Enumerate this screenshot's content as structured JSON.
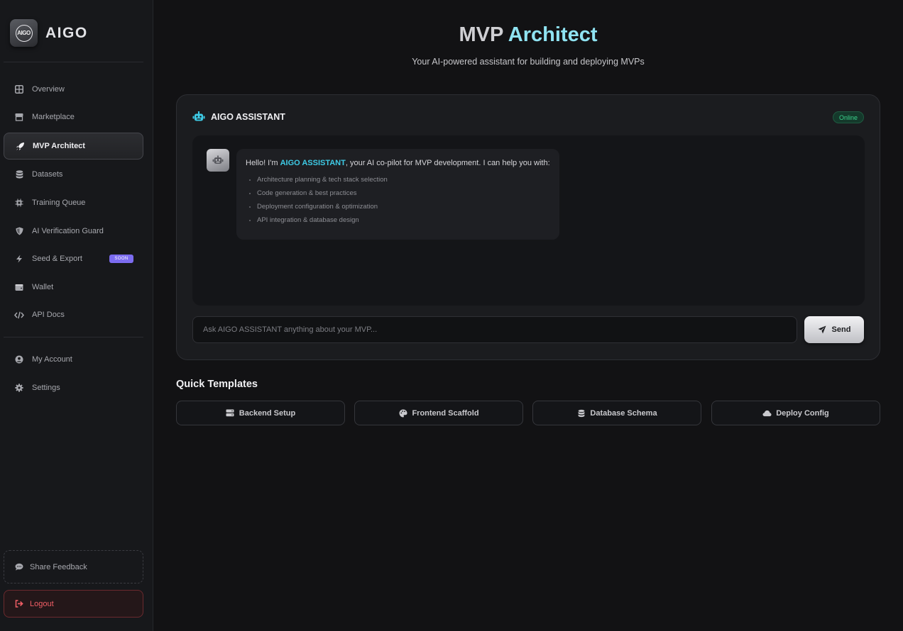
{
  "brand": {
    "name": "AIGO",
    "logo_text": "AIGO"
  },
  "sidebar": {
    "items": [
      {
        "label": "Overview",
        "icon": "grid-icon"
      },
      {
        "label": "Marketplace",
        "icon": "store-icon"
      },
      {
        "label": "MVP Architect",
        "icon": "rocket-icon",
        "active": true
      },
      {
        "label": "Datasets",
        "icon": "database-icon"
      },
      {
        "label": "Training Queue",
        "icon": "chip-icon"
      },
      {
        "label": "AI Verification Guard",
        "icon": "shield-icon"
      },
      {
        "label": "Seed & Export",
        "icon": "bolt-icon",
        "badge": "SOON"
      },
      {
        "label": "Wallet",
        "icon": "wallet-icon"
      },
      {
        "label": "API Docs",
        "icon": "code-icon"
      }
    ],
    "account_items": [
      {
        "label": "My Account",
        "icon": "user-icon"
      },
      {
        "label": "Settings",
        "icon": "gear-icon"
      }
    ],
    "feedback_label": "Share Feedback",
    "logout_label": "Logout"
  },
  "header": {
    "title_part1": "MVP",
    "title_part2": "Architect",
    "subtitle": "Your AI-powered assistant for building and deploying MVPs"
  },
  "assistant": {
    "title": "AIGO ASSISTANT",
    "status": "Online",
    "message": {
      "intro_before": "Hello! I'm ",
      "intro_highlight": "AIGO ASSISTANT",
      "intro_after": ", your AI co-pilot for MVP development. I can help you with:",
      "bullets": [
        "Architecture planning & tech stack selection",
        "Code generation & best practices",
        "Deployment configuration & optimization",
        "API integration & database design"
      ]
    },
    "input_placeholder": "Ask AIGO ASSISTANT anything about your MVP...",
    "send_label": "Send"
  },
  "templates": {
    "title": "Quick Templates",
    "items": [
      {
        "label": "Backend Setup",
        "icon": "server-icon"
      },
      {
        "label": "Frontend Scaffold",
        "icon": "palette-icon"
      },
      {
        "label": "Database Schema",
        "icon": "database-icon"
      },
      {
        "label": "Deploy Config",
        "icon": "cloud-icon"
      }
    ]
  },
  "colors": {
    "accent_cyan": "#3ecbe6",
    "title_cyan": "#8fe3f2",
    "online_green": "#3bd28c",
    "soon_purple": "#7c6cf0",
    "logout_red": "#f25f66"
  }
}
